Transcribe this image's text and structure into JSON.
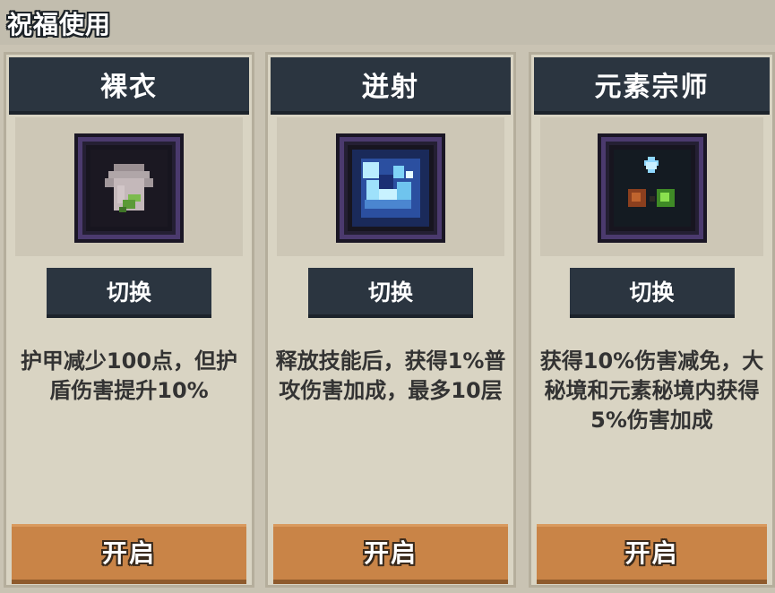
{
  "panel": {
    "title": "祝福使用"
  },
  "cards": [
    {
      "name": "裸衣",
      "icon": "robe-leaf-icon",
      "switch_label": "切换",
      "description": "护甲减少100点，但护盾伤害提升10%",
      "open_label": "开启"
    },
    {
      "name": "迸射",
      "icon": "ice-burst-icon",
      "switch_label": "切换",
      "description": "释放技能后，获得1%普攻伤害加成，最多10层",
      "open_label": "开启"
    },
    {
      "name": "元素宗师",
      "icon": "element-orbs-icon",
      "switch_label": "切换",
      "description": "获得10%伤害减免，大秘境和元素秘境内获得5%伤害加成",
      "open_label": "开启"
    }
  ],
  "colors": {
    "header_bg": "#2b3540",
    "card_bg": "#d9d4c3",
    "open_button": "#c98447",
    "icon_frame": "#4b3a6e"
  }
}
